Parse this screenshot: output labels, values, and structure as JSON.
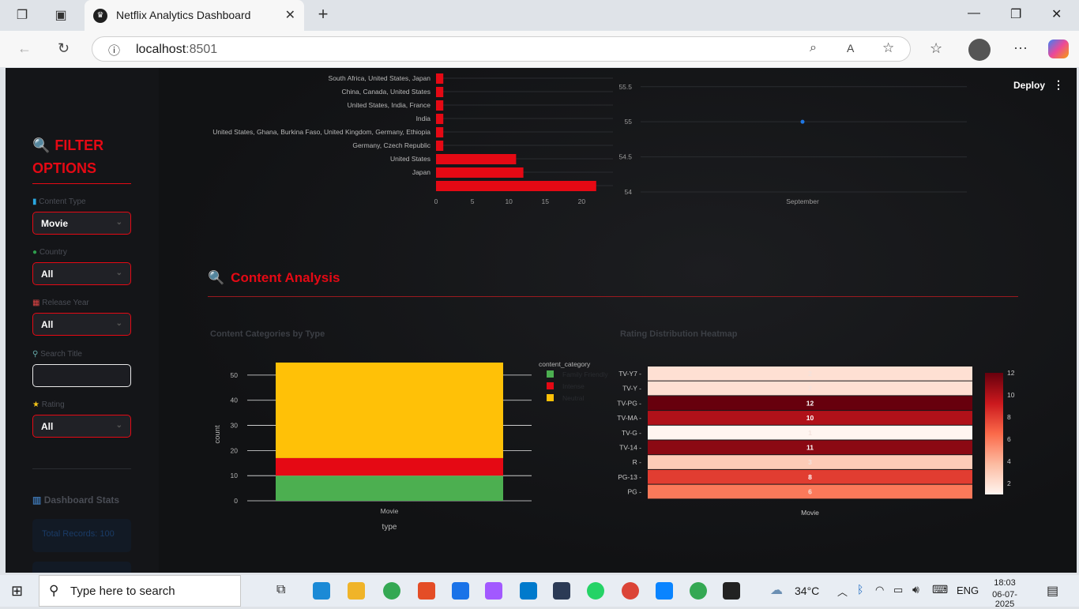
{
  "browser": {
    "tab_title": "Netflix Analytics Dashboard",
    "url_host": "localhost",
    "url_port": ":8501"
  },
  "app": {
    "deploy_label": "Deploy",
    "filter_title": "FILTER OPTIONS",
    "filters": {
      "content_type_label": "Content Type",
      "content_type_value": "Movie",
      "country_label": "Country",
      "country_value": "All",
      "release_year_label": "Release Year",
      "release_year_value": "All",
      "search_label": "Search Title",
      "search_value": "",
      "rating_label": "Rating",
      "rating_value": "All"
    },
    "stats_title": "Dashboard Stats",
    "total_records": "Total Records: 100",
    "section_title": "Content Analysis",
    "chart_titles": {
      "categories": "Content Categories by Type",
      "heatmap": "Rating Distribution Heatmap"
    }
  },
  "chart_data": [
    {
      "type": "bar",
      "orientation": "horizontal",
      "categories": [
        "South Africa, United States, Japan",
        "China, Canada, United States",
        "United States, India, France",
        "India",
        "United States, Ghana, Burkina Faso, United Kingdom, Germany, Ethiopia",
        "Germany, Czech Republic",
        "United States",
        "Japan",
        ""
      ],
      "values": [
        1,
        1,
        1,
        1,
        1,
        1,
        11,
        12,
        22
      ],
      "xticks": [
        "0",
        "5",
        "10",
        "15",
        "20"
      ],
      "xlim": [
        0,
        23
      ],
      "color": "#e50914"
    },
    {
      "type": "scatter",
      "x": [
        "September"
      ],
      "y": [
        55
      ],
      "yticks": [
        "54",
        "54.5",
        "55",
        "55.5"
      ],
      "ylim": [
        54,
        55.7
      ],
      "color": "#1f77e4"
    },
    {
      "type": "bar",
      "stacked": true,
      "categories": [
        "Movie"
      ],
      "xlabel": "type",
      "ylabel": "count",
      "ylim": [
        0,
        55
      ],
      "yticks": [
        "0",
        "10",
        "20",
        "30",
        "40",
        "50"
      ],
      "legend_title": "content_category",
      "series": [
        {
          "name": "Family Friendly",
          "values": [
            10
          ],
          "color": "#4caf50"
        },
        {
          "name": "Intense",
          "values": [
            7
          ],
          "color": "#e50914"
        },
        {
          "name": "Neutral",
          "values": [
            38
          ],
          "color": "#ffc107"
        }
      ]
    },
    {
      "type": "heatmap",
      "x": [
        "Movie"
      ],
      "y": [
        "TV-Y7",
        "TV-Y",
        "TV-PG",
        "TV-MA",
        "TV-G",
        "TV-14",
        "R",
        "PG-13",
        "PG"
      ],
      "values": [
        2,
        2,
        12,
        10,
        1,
        11,
        3,
        8,
        6
      ],
      "zlim": [
        1,
        12
      ],
      "colorbar_ticks": [
        "2",
        "4",
        "6",
        "8",
        "10",
        "12"
      ]
    }
  ],
  "taskbar": {
    "search_placeholder": "Type here to search",
    "weather": "34°C",
    "lang": "ENG",
    "time": "18:03",
    "date": "06-07-2025"
  }
}
